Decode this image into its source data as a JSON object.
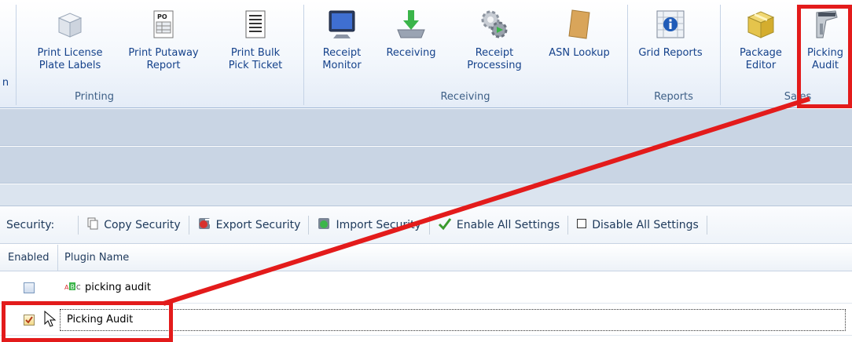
{
  "ribbon": {
    "buttons": [
      {
        "id": "partial",
        "label": "n",
        "icon": "partial-icon"
      },
      {
        "id": "print-license",
        "label": "Print License\nPlate Labels",
        "icon": "box-icon"
      },
      {
        "id": "print-putaway",
        "label": "Print Putaway\nReport",
        "icon": "po-document-icon"
      },
      {
        "id": "print-bulk",
        "label": "Print Bulk\nPick Ticket",
        "icon": "list-document-icon"
      },
      {
        "id": "receipt-monitor",
        "label": "Receipt\nMonitor",
        "icon": "monitor-icon"
      },
      {
        "id": "receiving",
        "label": "Receiving",
        "icon": "download-tray-icon"
      },
      {
        "id": "receipt-processing",
        "label": "Receipt\nProcessing",
        "icon": "gears-icon"
      },
      {
        "id": "asn-lookup",
        "label": "ASN Lookup",
        "icon": "envelope-icon"
      },
      {
        "id": "grid-reports",
        "label": "Grid Reports",
        "icon": "info-grid-icon"
      },
      {
        "id": "package-editor",
        "label": "Package\nEditor",
        "icon": "package-icon"
      },
      {
        "id": "picking-audit",
        "label": "Picking\nAudit",
        "icon": "barcode-scanner-icon"
      }
    ],
    "groups": {
      "printing": "Printing",
      "receiving": "Receiving",
      "reports": "Reports",
      "sales": "Sales"
    }
  },
  "toolbar": {
    "label": "Security:",
    "copy": "Copy Security",
    "export": "Export Security",
    "import": "Import Security",
    "enable_all": "Enable All Settings",
    "disable_all": "Disable All Settings"
  },
  "grid": {
    "headers": {
      "enabled": "Enabled",
      "plugin_name": "Plugin Name"
    },
    "rows": [
      {
        "enabled": false,
        "name": "picking audit",
        "icon": "abc-field-icon"
      },
      {
        "enabled": true,
        "name": "Picking Audit"
      }
    ]
  },
  "colors": {
    "annotation": "#e31b1b",
    "ribbon_text": "#15428b"
  }
}
